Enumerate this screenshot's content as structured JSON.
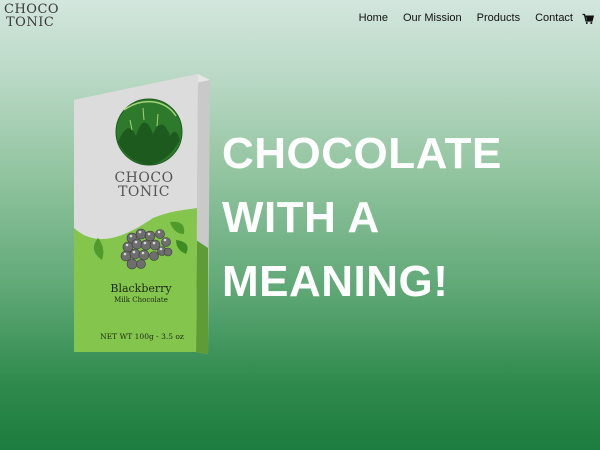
{
  "brand": {
    "line1": "CHOCO",
    "line2": "TONIC"
  },
  "nav": {
    "items": [
      "Home",
      "Our Mission",
      "Products",
      "Contact"
    ],
    "cart_icon": "cart-icon"
  },
  "product": {
    "brand_line1": "CHOCO",
    "brand_line2": "TONIC",
    "flavor": "Blackberry",
    "type": "Milk Chocolate",
    "net_weight": "NET WT 100g - 3.5 oz"
  },
  "hero": {
    "line1": "CHOCOLATE",
    "line2": "WITH A",
    "line3": "MEANING!"
  },
  "colors": {
    "accent_green": "#1d7c3f",
    "pack_green": "#7fc24a",
    "hero_text": "#ffffff"
  }
}
